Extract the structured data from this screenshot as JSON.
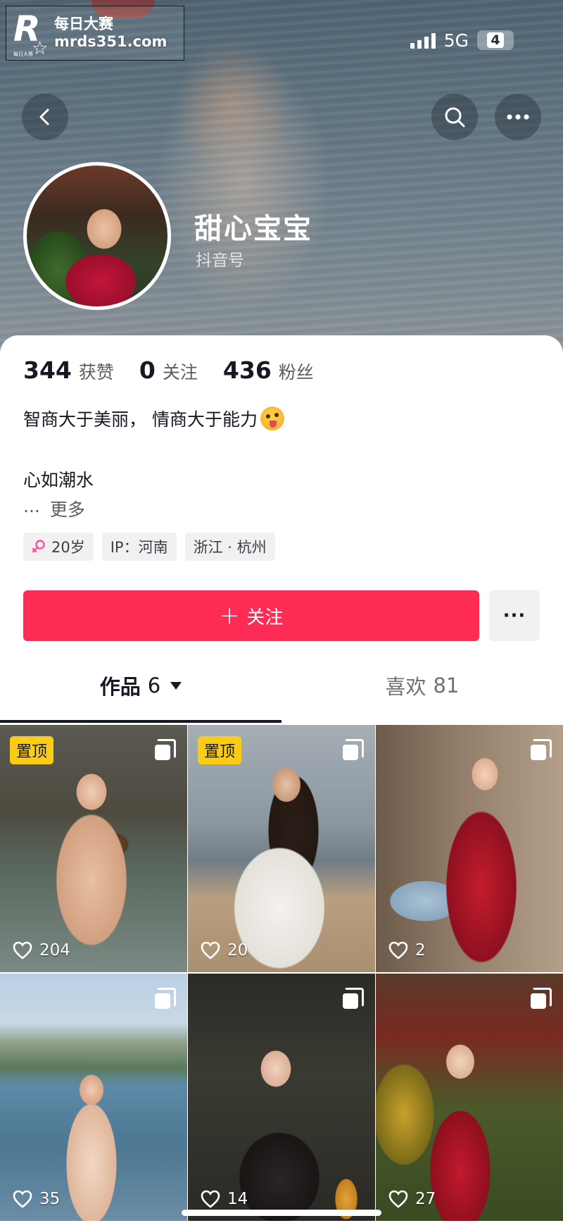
{
  "watermark": {
    "title": "每日大赛",
    "url": "mrds351.com",
    "logo_letter": "R",
    "logo_sub": "每日大赛"
  },
  "status_bar": {
    "network": "5G",
    "battery": "4"
  },
  "profile": {
    "nickname": "甜心宝宝",
    "douyin_id_label": "抖音号",
    "stats": [
      {
        "value": "344",
        "label": "获赞"
      },
      {
        "value": "0",
        "label": "关注"
      },
      {
        "value": "436",
        "label": "粉丝"
      }
    ],
    "bio_line1": "智商大于美丽， 情商大于能力",
    "bio_emoji": "winking-tongue-emoji",
    "bio_line2": "心如潮水",
    "ellipsis": "...",
    "more_label": "更多",
    "tags": {
      "age": "20岁",
      "ip": "IP：河南",
      "location": "浙江 · 杭州"
    }
  },
  "actions": {
    "follow_plus": "+",
    "follow_label": "关注",
    "more_label": "···"
  },
  "tabs": {
    "works": {
      "label": "作品",
      "count": "6"
    },
    "likes": {
      "label": "喜欢",
      "count": "81"
    }
  },
  "posts": [
    {
      "likes": "204",
      "pinned": "置顶"
    },
    {
      "likes": "20",
      "pinned": "置顶"
    },
    {
      "likes": "2"
    },
    {
      "likes": "35"
    },
    {
      "likes": "14"
    },
    {
      "likes": "27"
    }
  ],
  "colors": {
    "accent": "#fe2c55",
    "pin_badge": "#facc15",
    "female_icon": "#ff4fa0"
  }
}
